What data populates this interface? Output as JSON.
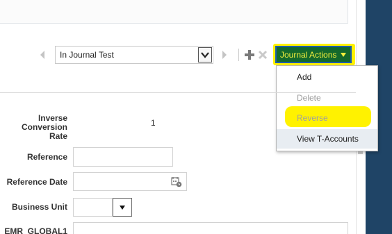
{
  "toolbar": {
    "journal_select_value": "In Journal Test",
    "journal_actions_label": "Journal Actions"
  },
  "journal_actions_menu": {
    "items": [
      {
        "label": "Add",
        "enabled": true
      },
      {
        "label": "Delete",
        "enabled": false
      },
      {
        "label": "Reverse",
        "enabled": false,
        "highlighted": true
      },
      {
        "label": "View T-Accounts",
        "enabled": true,
        "hovered": true
      }
    ]
  },
  "form": {
    "inverse_conversion_rate": {
      "label": "Inverse Conversion Rate",
      "value": "1"
    },
    "reference": {
      "label": "Reference",
      "value": ""
    },
    "reference_date": {
      "label": "Reference Date",
      "value": ""
    },
    "business_unit": {
      "label": "Business Unit",
      "value": ""
    },
    "emr_global1": {
      "label": "EMR_GLOBAL1",
      "value": ""
    }
  },
  "icons": {
    "prev": "chevron-left-icon",
    "next": "chevron-right-icon",
    "select_toggle": "chevron-down-icon",
    "add": "plus-icon",
    "delete": "x-icon",
    "calendar": "calendar-icon",
    "bu_toggle": "triangle-down-icon"
  },
  "colors": {
    "highlight": "#fff200",
    "journal_actions_bg": "#14692c",
    "journal_actions_border": "#1f5fa8",
    "right_strip": "#1f4466",
    "menu_hover": "#e8edf2"
  }
}
